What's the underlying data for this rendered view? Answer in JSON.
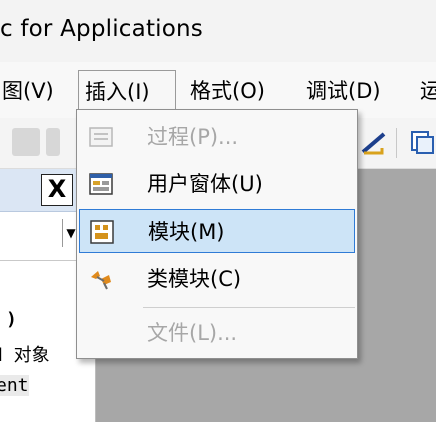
{
  "window": {
    "title": "c for Applications"
  },
  "menubar": {
    "items": [
      {
        "label": "图(V)"
      },
      {
        "label": "插入(I)"
      },
      {
        "label": "格式(O)"
      },
      {
        "label": "调试(D)"
      },
      {
        "label": "运"
      }
    ],
    "active_index": 1
  },
  "insert_menu": {
    "items": [
      {
        "label": "过程(P)...",
        "icon": "procedure-icon",
        "enabled": false
      },
      {
        "label": "用户窗体(U)",
        "icon": "userform-icon",
        "enabled": true
      },
      {
        "label": "模块(M)",
        "icon": "module-icon",
        "enabled": true,
        "selected": true
      },
      {
        "label": "类模块(C)",
        "icon": "class-module-icon",
        "enabled": true
      },
      {
        "label": "文件(L)...",
        "icon": "file-icon",
        "enabled": false
      }
    ]
  },
  "left_pane": {
    "close_label": "X",
    "code_lines": [
      ")",
      "d 对象",
      "ent"
    ]
  },
  "colors": {
    "selection_bg": "#cde4f7",
    "selection_border": "#2f7bd6",
    "work_area": "#a7a7a7",
    "pane_header": "#dbe6f4"
  }
}
